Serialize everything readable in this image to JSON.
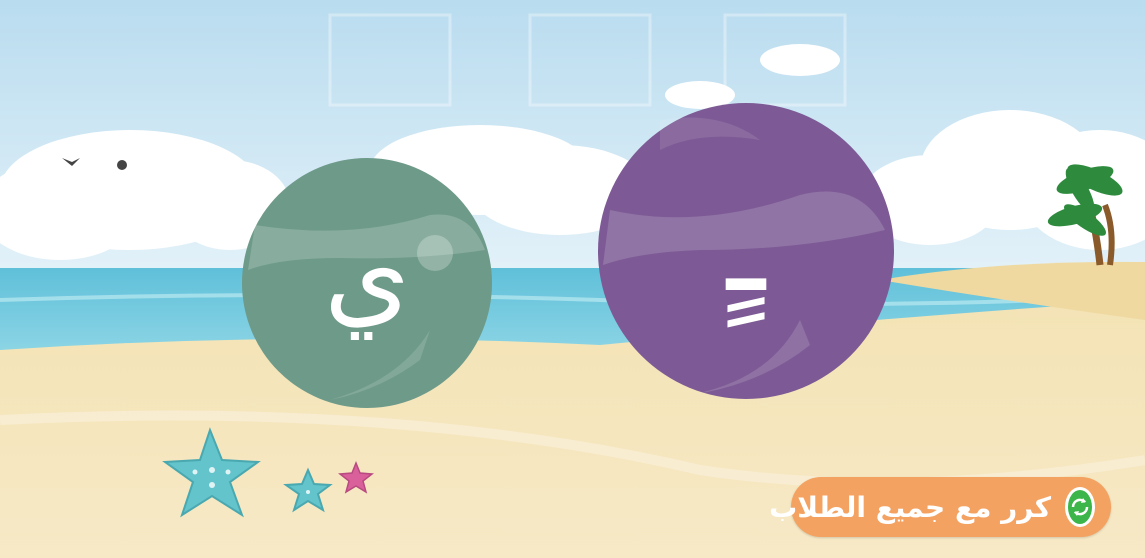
{
  "balls": {
    "left_letter": "ي",
    "right_letter": "ـٍ",
    "left_color": "#6e9a89",
    "right_color": "#7d5a95"
  },
  "instruction": {
    "label": "كرر مع جميع الطلاب",
    "icon": "repeat-cycle-icon",
    "pill_color": "#f4a261",
    "icon_color": "#3cb54a"
  }
}
